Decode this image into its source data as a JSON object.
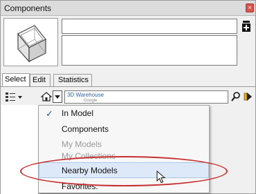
{
  "window": {
    "title": "Components",
    "close_glyph": "×"
  },
  "component": {
    "name_value": "",
    "description_value": ""
  },
  "tabs": [
    {
      "label": "Select",
      "active": true
    },
    {
      "label": "Edit",
      "active": false
    },
    {
      "label": "Statistics",
      "active": false
    }
  ],
  "toolbar": {
    "search_value": "",
    "warehouse_logo": "3D Warehouse",
    "warehouse_sub": "Google"
  },
  "menu": {
    "items": [
      {
        "label": "In Model",
        "checked": true,
        "disabled": false,
        "highlighted": false
      },
      {
        "label": "Components",
        "checked": false,
        "disabled": false,
        "highlighted": false
      },
      {
        "label": "My Models",
        "checked": false,
        "disabled": true,
        "highlighted": false
      },
      {
        "label": "My Collections",
        "checked": false,
        "disabled": true,
        "highlighted": false
      },
      {
        "label": "Nearby Models",
        "checked": false,
        "disabled": false,
        "highlighted": true
      },
      {
        "label": "Favorites:",
        "checked": false,
        "disabled": false,
        "highlighted": false
      }
    ],
    "check_glyph": "✓"
  },
  "colors": {
    "annotation": "#c62f2f",
    "highlight": "#dde9f8",
    "accent": "#2a4f9a"
  }
}
